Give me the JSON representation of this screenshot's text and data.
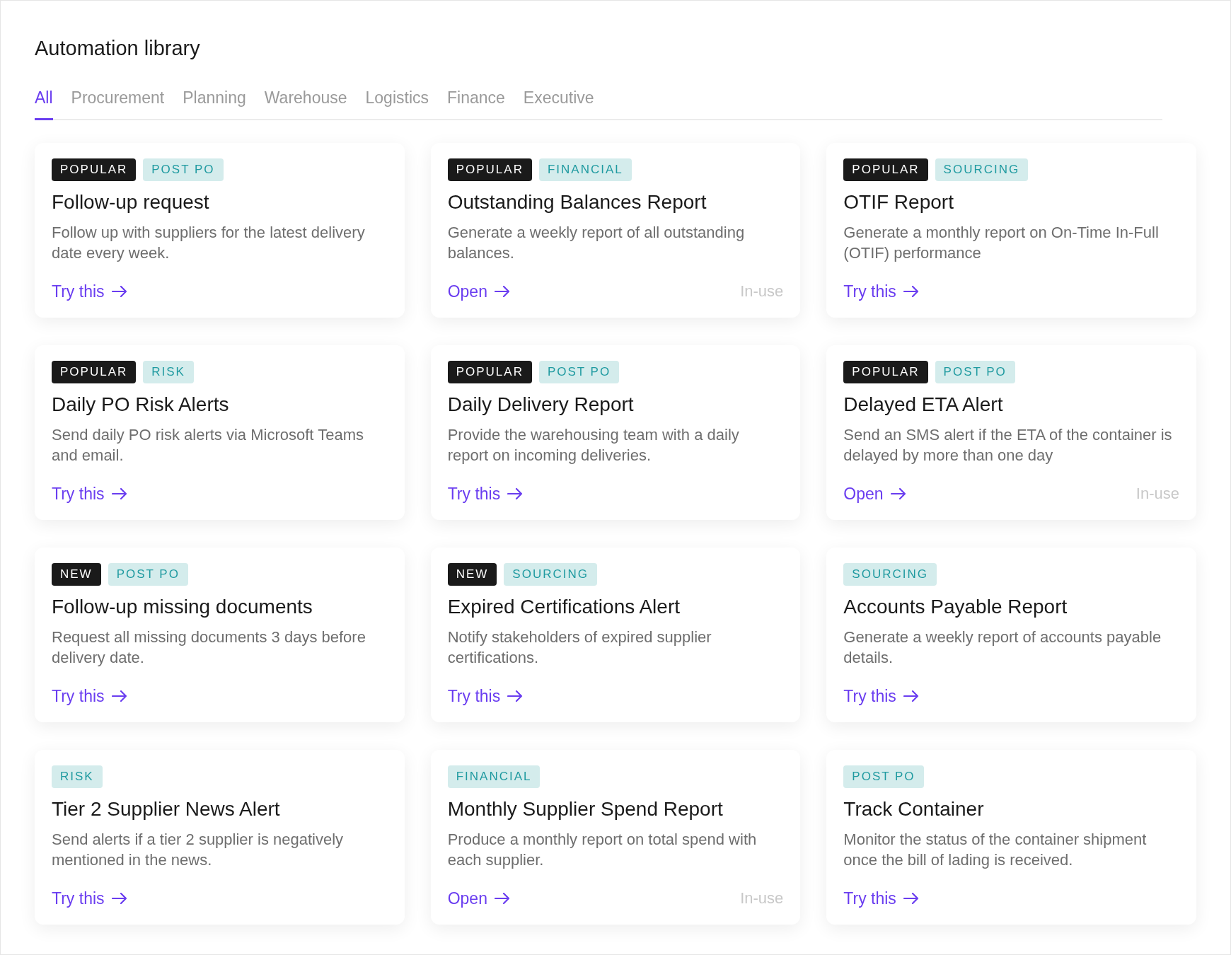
{
  "title": "Automation library",
  "tabs": [
    {
      "label": "All",
      "selected": true
    },
    {
      "label": "Procurement",
      "selected": false
    },
    {
      "label": "Planning",
      "selected": false
    },
    {
      "label": "Warehouse",
      "selected": false
    },
    {
      "label": "Logistics",
      "selected": false
    },
    {
      "label": "Finance",
      "selected": false
    },
    {
      "label": "Executive",
      "selected": false
    }
  ],
  "cards": [
    {
      "tags": [
        {
          "label": "POPULAR",
          "kind": "highlight"
        },
        {
          "label": "POST PO",
          "kind": "category"
        }
      ],
      "title": "Follow-up request",
      "description": "Follow up with suppliers for the latest delivery date every week.",
      "action": "Try this"
    },
    {
      "tags": [
        {
          "label": "POPULAR",
          "kind": "highlight"
        },
        {
          "label": "FINANCIAL",
          "kind": "category"
        }
      ],
      "title": "Outstanding Balances Report",
      "description": "Generate a weekly report of all outstanding balances.",
      "action": "Open",
      "status": "In-use"
    },
    {
      "tags": [
        {
          "label": "POPULAR",
          "kind": "highlight"
        },
        {
          "label": "SOURCING",
          "kind": "category"
        }
      ],
      "title": "OTIF Report",
      "description": "Generate a monthly report on On-Time In-Full (OTIF) performance",
      "action": "Try this"
    },
    {
      "tags": [
        {
          "label": "POPULAR",
          "kind": "highlight"
        },
        {
          "label": "RISK",
          "kind": "category"
        }
      ],
      "title": "Daily PO Risk Alerts",
      "description": "Send daily PO risk alerts via Microsoft Teams and email.",
      "action": "Try this"
    },
    {
      "tags": [
        {
          "label": "POPULAR",
          "kind": "highlight"
        },
        {
          "label": "POST PO",
          "kind": "category"
        }
      ],
      "title": "Daily Delivery Report",
      "description": "Provide the warehousing team with a daily report on incoming deliveries.",
      "action": "Try this"
    },
    {
      "tags": [
        {
          "label": "POPULAR",
          "kind": "highlight"
        },
        {
          "label": "POST PO",
          "kind": "category"
        }
      ],
      "title": "Delayed ETA Alert",
      "description": "Send an SMS alert if the ETA of the container is delayed by more than one day",
      "action": "Open",
      "status": "In-use"
    },
    {
      "tags": [
        {
          "label": "NEW",
          "kind": "highlight"
        },
        {
          "label": "POST PO",
          "kind": "category"
        }
      ],
      "title": "Follow-up missing documents",
      "description": "Request all missing documents 3 days before delivery date.",
      "action": "Try this"
    },
    {
      "tags": [
        {
          "label": "NEW",
          "kind": "highlight"
        },
        {
          "label": "SOURCING",
          "kind": "category"
        }
      ],
      "title": "Expired Certifications Alert",
      "description": "Notify stakeholders of expired supplier certifications.",
      "action": "Try this"
    },
    {
      "tags": [
        {
          "label": "SOURCING",
          "kind": "category"
        }
      ],
      "title": "Accounts Payable Report",
      "description": "Generate a weekly report of accounts payable details.",
      "action": "Try this"
    },
    {
      "tags": [
        {
          "label": "RISK",
          "kind": "category"
        }
      ],
      "title": "Tier 2 Supplier News Alert",
      "description": "Send alerts if a tier 2 supplier is negatively mentioned in the news.",
      "action": "Try this"
    },
    {
      "tags": [
        {
          "label": "FINANCIAL",
          "kind": "category"
        }
      ],
      "title": "Monthly Supplier Spend Report",
      "description": "Produce a monthly report on total spend with each supplier.",
      "action": "Open",
      "status": "In-use"
    },
    {
      "tags": [
        {
          "label": "POST PO",
          "kind": "category"
        }
      ],
      "title": "Track Container",
      "description": "Monitor the status of the container shipment once the bill of lading is received.",
      "action": "Try this"
    }
  ]
}
